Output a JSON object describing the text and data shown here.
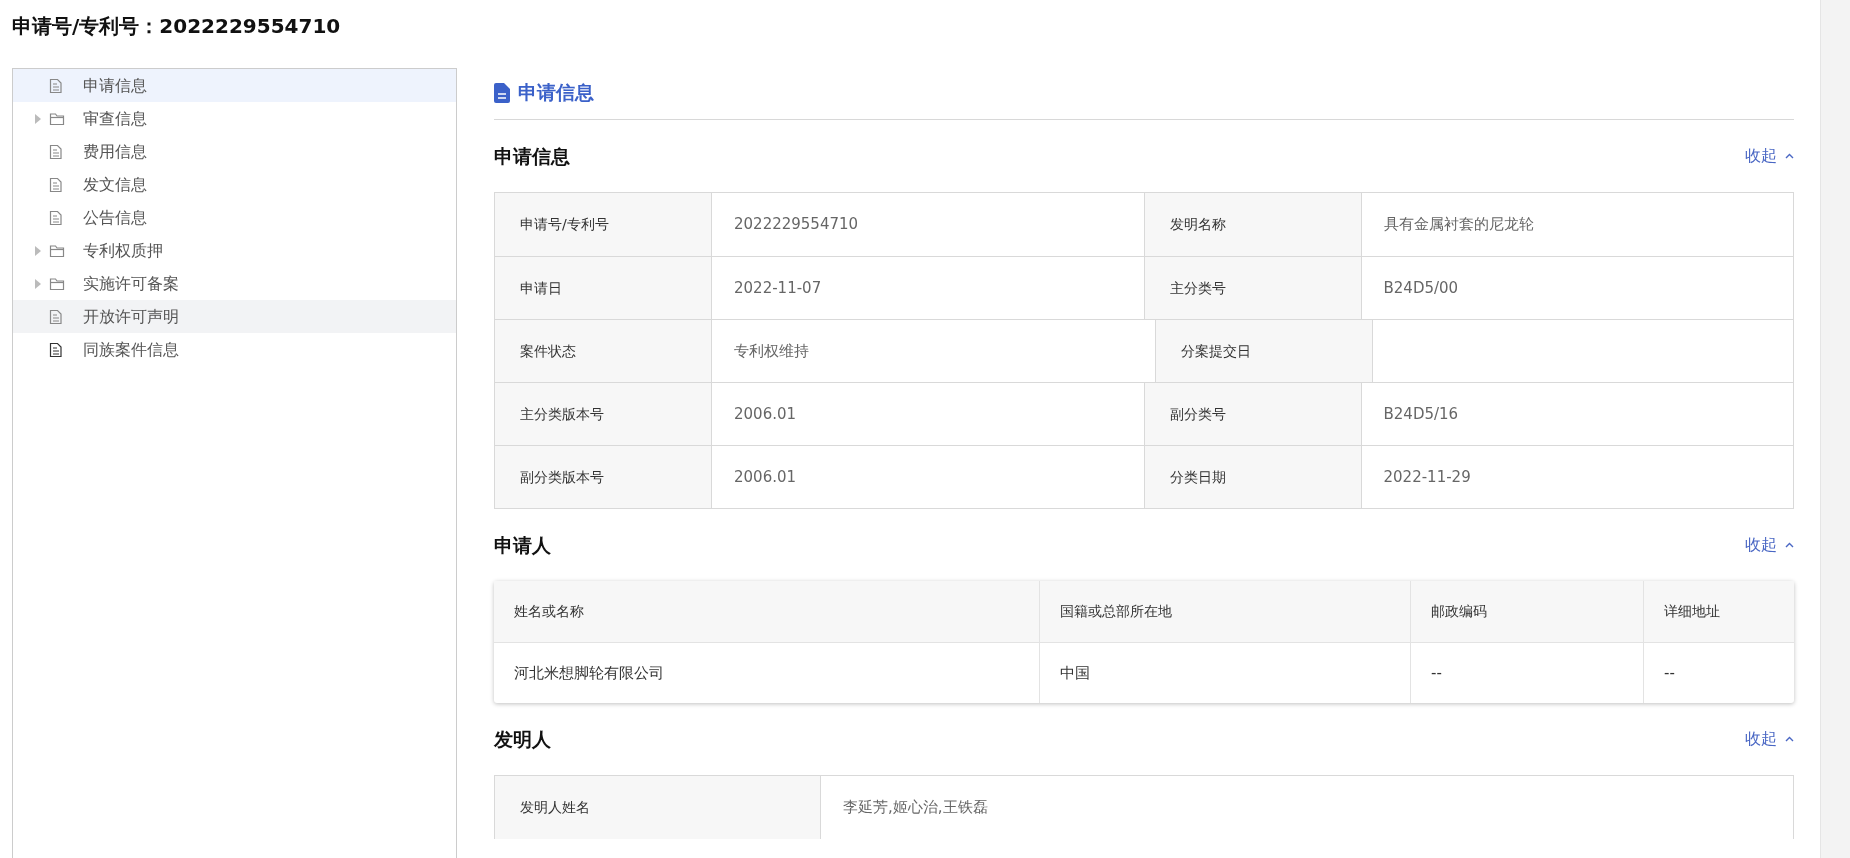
{
  "page_title": "申请号/专利号：2022229554710",
  "sidebar": {
    "items": [
      {
        "label": "申请信息",
        "kind": "file",
        "selected": true,
        "highlighted": false
      },
      {
        "label": "审查信息",
        "kind": "folder",
        "selected": false,
        "highlighted": false,
        "expanded": false
      },
      {
        "label": "费用信息",
        "kind": "file",
        "selected": false,
        "highlighted": false
      },
      {
        "label": "发文信息",
        "kind": "file",
        "selected": false,
        "highlighted": false
      },
      {
        "label": "公告信息",
        "kind": "file",
        "selected": false,
        "highlighted": false
      },
      {
        "label": "专利权质押",
        "kind": "folder",
        "selected": false,
        "highlighted": false,
        "expanded": false
      },
      {
        "label": "实施许可备案",
        "kind": "folder",
        "selected": false,
        "highlighted": false,
        "expanded": false
      },
      {
        "label": "开放许可声明",
        "kind": "file",
        "selected": false,
        "highlighted": true
      },
      {
        "label": "同族案件信息",
        "kind": "file",
        "selected": false,
        "highlighted": false
      }
    ]
  },
  "content": {
    "heading": "申请信息",
    "application_section": {
      "title": "申请信息",
      "toggle": "收起",
      "expanded": true,
      "rows": [
        [
          {
            "label": "申请号/专利号",
            "value": "2022229554710"
          },
          {
            "label": "发明名称",
            "value": "具有金属衬套的尼龙轮"
          }
        ],
        [
          {
            "label": "申请日",
            "value": "2022-11-07"
          },
          {
            "label": "主分类号",
            "value": "B24D5/00"
          }
        ],
        [
          {
            "label": "案件状态",
            "value": "专利权维持"
          },
          {
            "label": "分案提交日"
          }
        ],
        [
          {
            "label": "主分类版本号",
            "value": "2006.01"
          },
          {
            "label": "副分类号",
            "value": "B24D5/16"
          }
        ],
        [
          {
            "label": "副分类版本号",
            "value": "2006.01"
          },
          {
            "label": "分类日期",
            "value": "2022-11-29"
          }
        ]
      ]
    },
    "applicant_section": {
      "title": "申请人",
      "toggle": "收起",
      "expanded": true,
      "columns": [
        "姓名或名称",
        "国籍或总部所在地",
        "邮政编码",
        "详细地址"
      ],
      "rows": [
        [
          "河北米想脚轮有限公司",
          "中国",
          "--",
          "--"
        ]
      ]
    },
    "inventor_section": {
      "title": "发明人",
      "toggle": "收起",
      "expanded": true,
      "rows": [
        {
          "label": "发明人姓名",
          "value": "李延芳,姬心治,王铁磊"
        }
      ]
    }
  }
}
